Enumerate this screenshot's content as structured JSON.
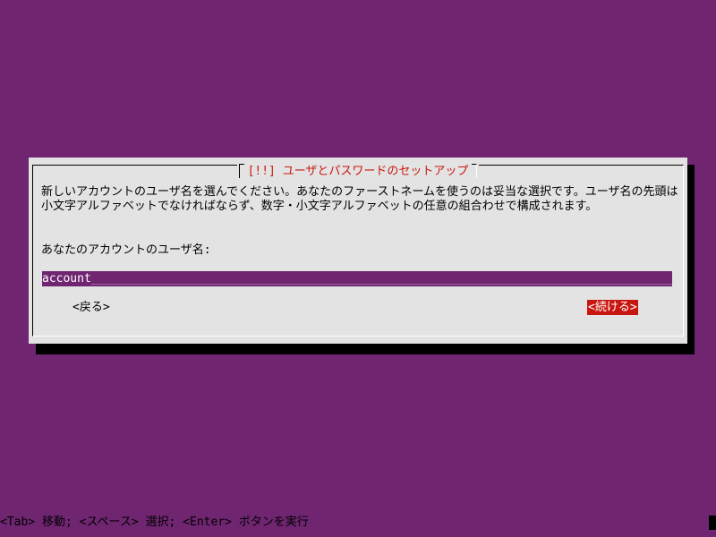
{
  "dialog": {
    "title": "[!!] ユーザとパスワードのセットアップ",
    "message": "新しいアカウントのユーザ名を選んでください。あなたのファーストネームを使うのは妥当な選択です。ユーザ名の先頭は小文字アルファベットでなければならず、数字・小文字アルファベットの任意の組合わせで構成されます。",
    "prompt": "あなたのアカウントのユーザ名:",
    "input_value": "account",
    "input_fill": "_________________________________________________________________________________________________",
    "back_label": "<戻る>",
    "continue_label": "<続ける>"
  },
  "status_bar": {
    "text": "<Tab> 移動; <スペース> 選択; <Enter> ボタンを実行"
  },
  "colors": {
    "background": "#6f2570",
    "dialog": "#e3e3e3",
    "accent": "#c8170f"
  }
}
